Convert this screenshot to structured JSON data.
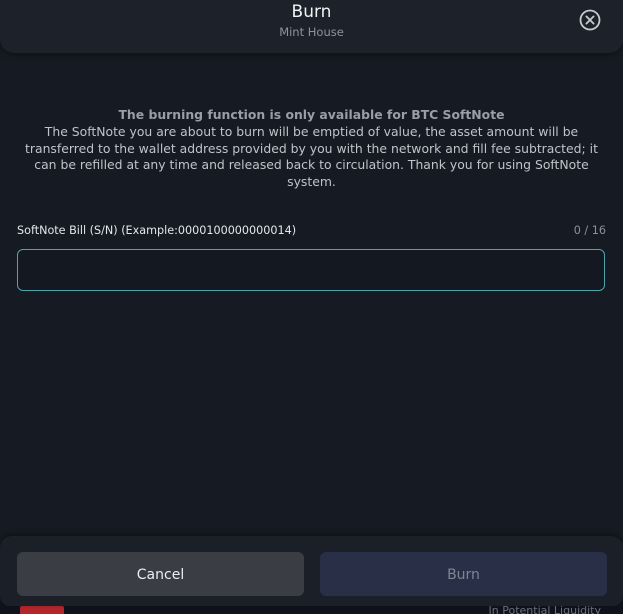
{
  "modal": {
    "title": "Burn",
    "subtitle": "Mint House",
    "close_icon": "close-circle-icon"
  },
  "notice": {
    "heading": "The burning function is only available for BTC SoftNote",
    "body": "The SoftNote you are about to burn will be emptied of value, the asset amount will be transferred to the wallet address provided by you with the network and fill fee subtracted; it can be refilled at any time and released back to circulation. Thank you for using SoftNote system."
  },
  "serial_field": {
    "label": "SoftNote Bill (S/N) (Example:0000100000000014)",
    "counter": "0 / 16",
    "value": "",
    "placeholder": ""
  },
  "footer": {
    "cancel_label": "Cancel",
    "burn_label": "Burn"
  },
  "background": {
    "liquidity_text": "In Potential Liquidity"
  },
  "colors": {
    "input_border": "#4fa3aa",
    "burn_button_bg": "#282f47",
    "cancel_button_bg": "#3a3d43"
  }
}
